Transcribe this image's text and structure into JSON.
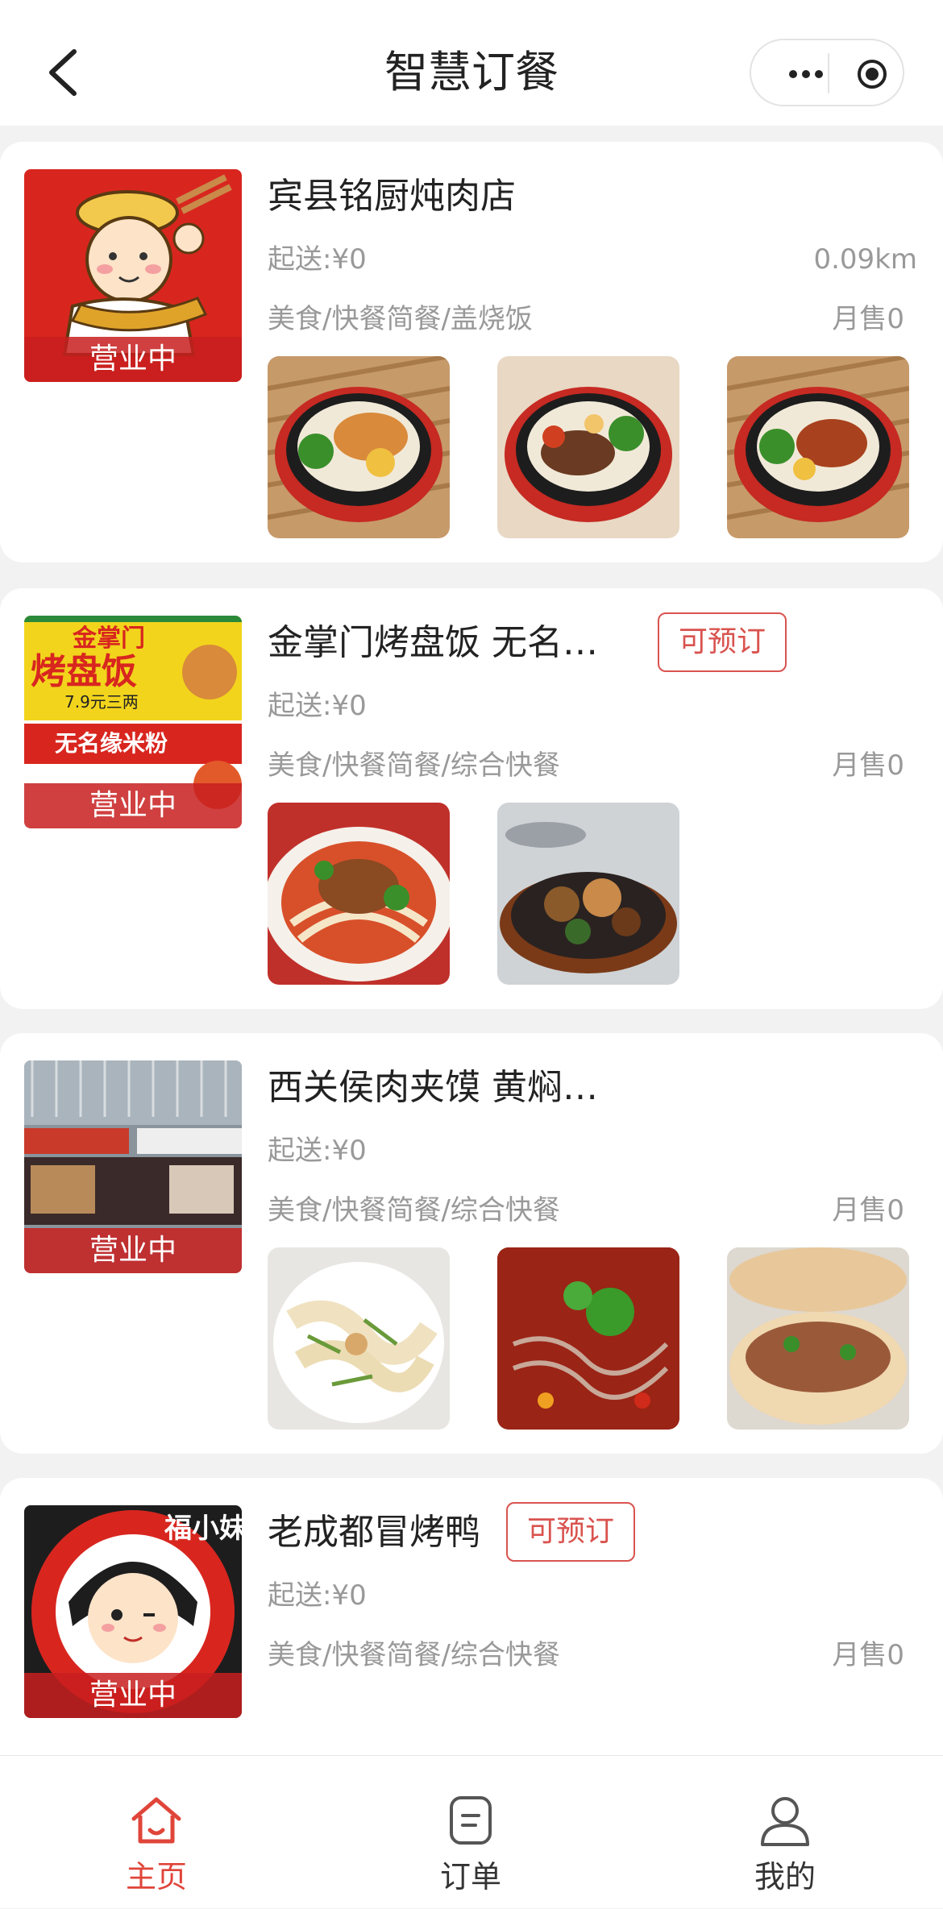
{
  "header": {
    "title": "智慧订餐",
    "back_icon": "chevron-left-icon",
    "more_icon": "more-dots-icon",
    "target_icon": "record-target-icon"
  },
  "colors": {
    "accent": "#e0453a",
    "badge_border": "#d9534f",
    "muted_text": "#999999"
  },
  "restaurants": [
    {
      "name": "宾县铭厨炖肉店",
      "status": "营业中",
      "min_order": "起送:¥0",
      "distance": "0.09km",
      "categories": "美食/快餐简餐/盖烧饭",
      "monthly_sales": "月售0"
    },
    {
      "name": "金掌门烤盘饭 无名…",
      "badge": "可预订",
      "status": "营业中",
      "min_order": "起送:¥0",
      "categories": "美食/快餐简餐/综合快餐",
      "monthly_sales": "月售0",
      "logo_text": {
        "brand": "金掌门",
        "dish": "烤盘饭",
        "price": "7.9元三两",
        "brand2": "无名缘米粉"
      }
    },
    {
      "name": "西关侯肉夹馍 黄焖…",
      "status": "营业中",
      "min_order": "起送:¥0",
      "categories": "美食/快餐简餐/综合快餐",
      "monthly_sales": "月售0"
    },
    {
      "name": "老成都冒烤鸭",
      "badge": "可预订",
      "status": "营业中",
      "min_order": "起送:¥0",
      "categories": "美食/快餐简餐/综合快餐",
      "monthly_sales": "月售0",
      "logo_text": "福小妹"
    }
  ],
  "tabbar": {
    "items": [
      {
        "label": "主页",
        "icon": "home-icon",
        "active": true
      },
      {
        "label": "订单",
        "icon": "order-icon",
        "active": false
      },
      {
        "label": "我的",
        "icon": "profile-icon",
        "active": false
      }
    ]
  }
}
